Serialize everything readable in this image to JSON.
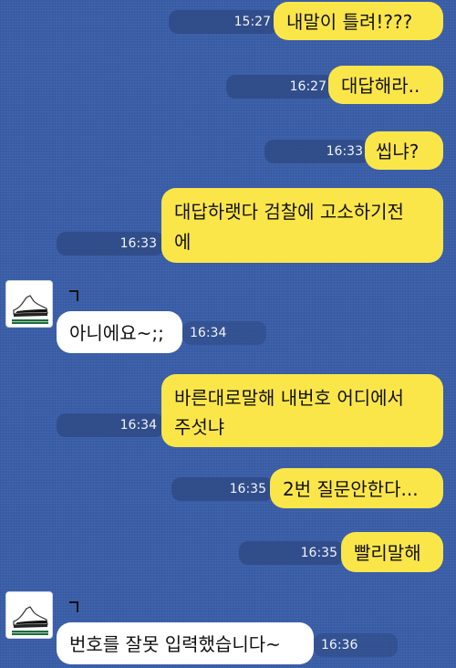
{
  "messages": [
    {
      "sender": "me",
      "text": "내말이 틀려!???",
      "time": "15:27"
    },
    {
      "sender": "me",
      "text": "대답해라..",
      "time": "16:27"
    },
    {
      "sender": "me",
      "text": "씹냐?",
      "time": "16:33"
    },
    {
      "sender": "me",
      "text_line1": "대답하랫다 검찰에 고소하기전",
      "text_line2": "에",
      "time": "16:33"
    },
    {
      "sender": "them",
      "text": "아니에요~;;",
      "time": "16:34"
    },
    {
      "sender": "me",
      "text_line1": "바른대로말해 내번호 어디에서",
      "text_line2": "주섯냐",
      "time": "16:34"
    },
    {
      "sender": "me",
      "text": "2번 질문안한다...",
      "time": "16:35"
    },
    {
      "sender": "me",
      "text": "빨리말해",
      "time": "16:35"
    },
    {
      "sender": "them",
      "text": "번호를 잘못 입력했습니다~",
      "time": "16:36"
    }
  ],
  "colors": {
    "background": "#3a5ea8",
    "my_bubble": "#fbe64a",
    "their_bubble": "#ffffff"
  },
  "icons": {
    "contact_avatar": "sneaker-icon"
  }
}
